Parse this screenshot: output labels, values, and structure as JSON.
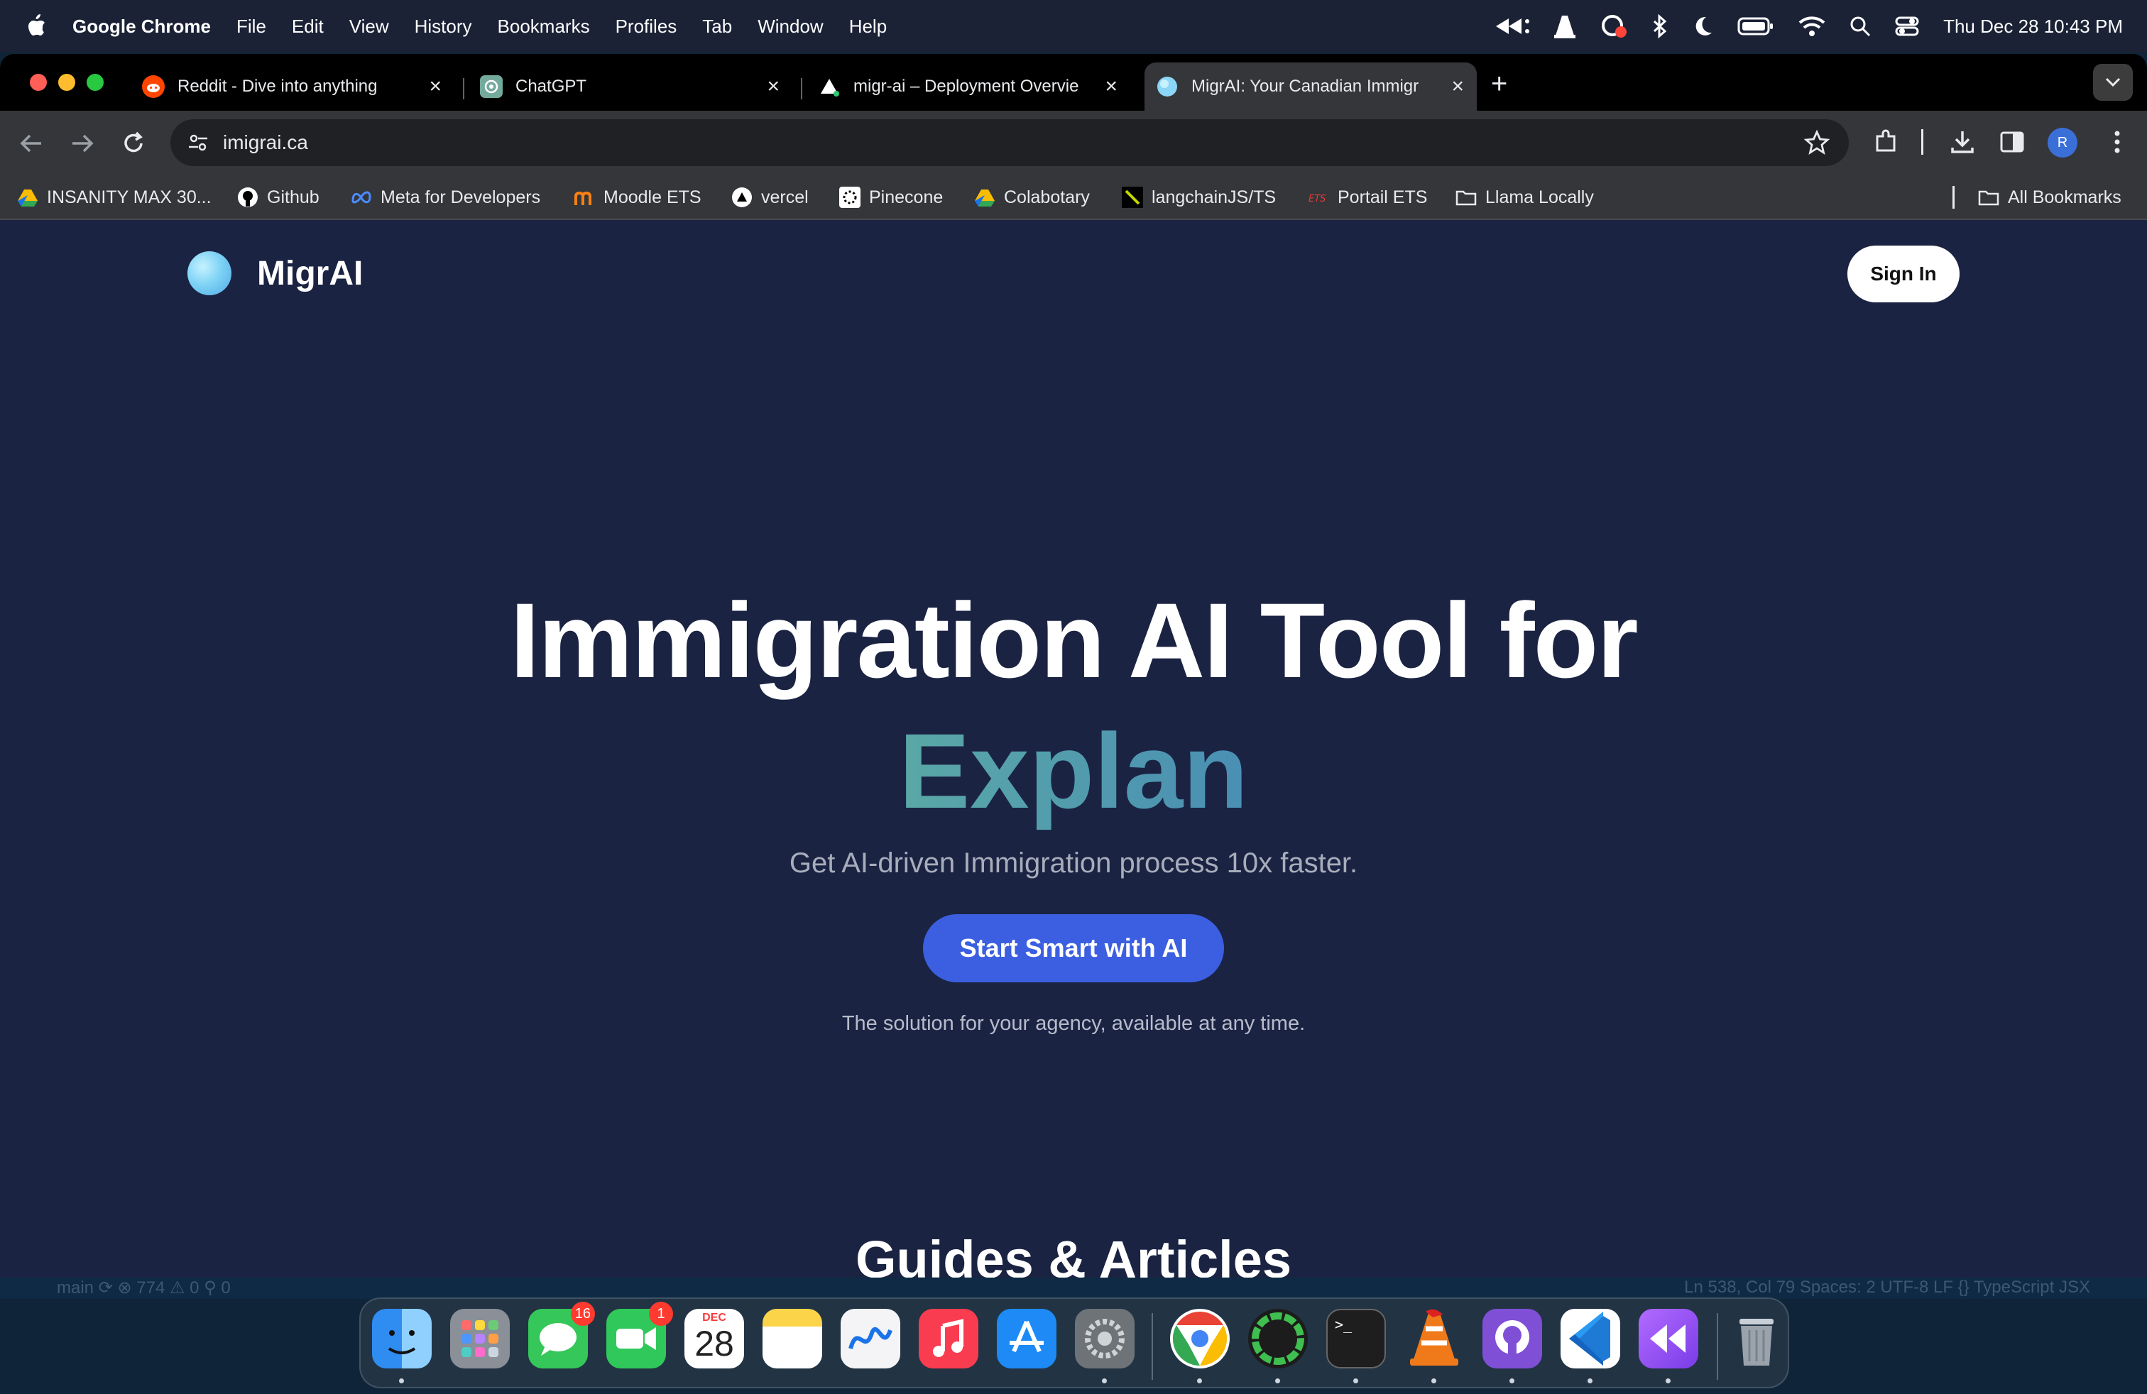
{
  "menubar": {
    "app_name": "Google Chrome",
    "items": [
      "File",
      "Edit",
      "View",
      "History",
      "Bookmarks",
      "Profiles",
      "Tab",
      "Window",
      "Help"
    ],
    "clock": "Thu Dec 28  10:43 PM"
  },
  "tabs": [
    {
      "title": "Reddit - Dive into anything",
      "icon": "reddit-icon",
      "active": false
    },
    {
      "title": "ChatGPT",
      "icon": "chatgpt-icon",
      "active": false
    },
    {
      "title": "migr-ai – Deployment Overvie",
      "icon": "vercel-icon",
      "active": false
    },
    {
      "title": "MigrAI: Your Canadian Immigr",
      "icon": "migrai-icon",
      "active": true
    }
  ],
  "address_bar": {
    "url": "imigrai.ca"
  },
  "profile_initial": "R",
  "bookmarks": [
    {
      "label": "INSANITY MAX 30...",
      "icon": "drive-icon"
    },
    {
      "label": "Github",
      "icon": "github-icon"
    },
    {
      "label": "Meta for Developers",
      "icon": "meta-icon"
    },
    {
      "label": "Moodle ETS",
      "icon": "moodle-icon"
    },
    {
      "label": "vercel",
      "icon": "vercel-icon"
    },
    {
      "label": "Pinecone",
      "icon": "pinecone-icon"
    },
    {
      "label": "Colabotary",
      "icon": "drive-icon"
    },
    {
      "label": "langchainJS/TS",
      "icon": "langchain-icon"
    },
    {
      "label": "Portail ETS",
      "icon": "ets-icon"
    },
    {
      "label": "Llama Locally",
      "icon": "folder-icon"
    }
  ],
  "all_bookmarks_label": "All Bookmarks",
  "page": {
    "brand": "MigrAI",
    "sign_in": "Sign In",
    "hero_title": "Immigration AI Tool for",
    "hero_accent": "Explan",
    "subtitle": "Get AI-driven Immigration process 10x faster.",
    "cta": "Start Smart with AI",
    "cta_note": "The solution for your agency, available at any time.",
    "guides_heading": "Guides & Articles"
  },
  "statusbar": {
    "left": "main  ⟳   ⊗ 774 ⚠ 0   ⚲ 0",
    "right": "Ln 538, Col 79   Spaces: 2   UTF-8   LF   {} TypeScript JSX"
  },
  "dock": {
    "apps": [
      {
        "name": "finder-icon",
        "color": "#2f8cf0"
      },
      {
        "name": "launchpad-icon",
        "color": "#8a8f98"
      },
      {
        "name": "messages-icon",
        "color": "#35c759",
        "badge": "16"
      },
      {
        "name": "facetime-icon",
        "color": "#30c85a",
        "badge": "1"
      },
      {
        "name": "calendar-icon",
        "color": "#ffffff",
        "month": "DEC",
        "day": "28"
      },
      {
        "name": "notes-icon",
        "color": "#fbd44a"
      },
      {
        "name": "freeform-icon",
        "color": "#f4f4f6"
      },
      {
        "name": "music-icon",
        "color": "#fa3c50"
      },
      {
        "name": "app-store-icon",
        "color": "#1d8af5"
      },
      {
        "name": "system-settings-icon",
        "color": "#6e7378"
      },
      {
        "name": "chrome-icon",
        "color": "#ffffff"
      },
      {
        "name": "ring-app-icon",
        "color": "#1c1c1c"
      },
      {
        "name": "terminal-icon",
        "color": "#1e1e1e"
      },
      {
        "name": "vlc-icon",
        "color": "#f07a1a"
      },
      {
        "name": "github-desktop-icon",
        "color": "#7f4fd6"
      },
      {
        "name": "vscode-icon",
        "color": "#1f7ad6"
      },
      {
        "name": "rewind-icon",
        "color": "#9a5bf0"
      },
      {
        "name": "trash-icon",
        "color": "#9aa3ab"
      }
    ]
  }
}
